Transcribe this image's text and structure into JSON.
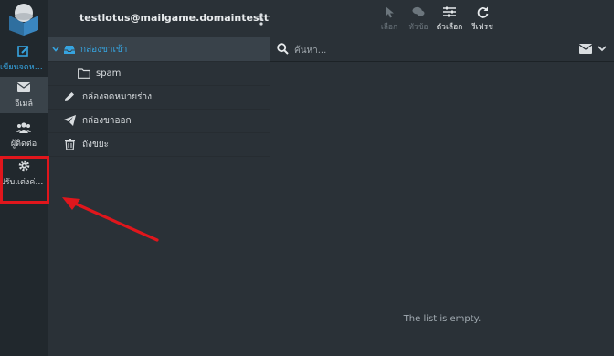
{
  "taskbar": {
    "compose_label": "เขียนจดหมาย",
    "mail_label": "อีเมล์",
    "contacts_label": "ผู้ติดต่อ",
    "settings_label": "ปรับแต่งค่าส่วนตัว"
  },
  "account": {
    "email": "testlotus@mailgame.domaintesttt.net"
  },
  "folders": [
    {
      "label": "กล่องขาเข้า"
    },
    {
      "label": "spam"
    },
    {
      "label": "กล่องจดหมายร่าง"
    },
    {
      "label": "กล่องขาออก"
    },
    {
      "label": "ถังขยะ"
    }
  ],
  "toolbar": {
    "select_label": "เลือก",
    "threads_label": "หัวข้อ",
    "options_label": "ตัวเลือก",
    "refresh_label": "รีเฟรช"
  },
  "search": {
    "placeholder": "ค้นหา..."
  },
  "list": {
    "empty_text": "The list is empty."
  },
  "colors": {
    "accent": "#36a4e0",
    "annotation": "#e0161c",
    "background": "#2a3137",
    "sidebar": "#21282d"
  },
  "icons": [
    "logo-icon",
    "compose-icon",
    "envelope-icon",
    "contacts-icon",
    "gear-icon",
    "kebab-menu-icon",
    "chevron-down-icon",
    "inbox-tray-icon",
    "folder-icon",
    "pencil-icon",
    "paper-plane-icon",
    "trash-icon",
    "cursor-icon",
    "chat-bubbles-icon",
    "sliders-icon",
    "refresh-icon",
    "search-icon"
  ]
}
